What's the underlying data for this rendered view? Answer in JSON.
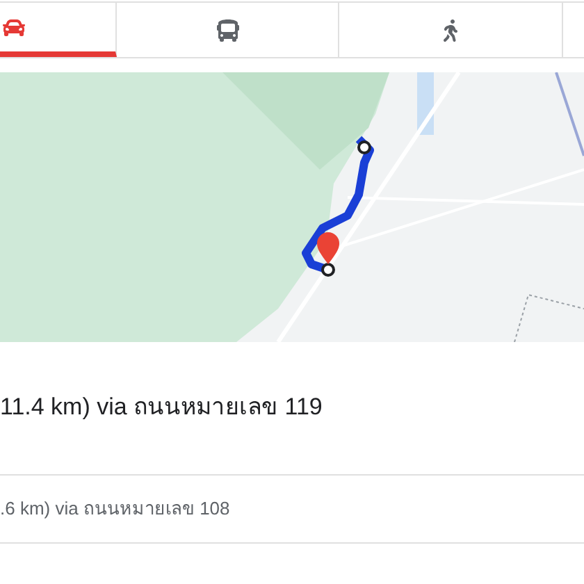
{
  "tabs": [
    {
      "kind": "car",
      "selected": true
    },
    {
      "kind": "transit",
      "selected": false
    },
    {
      "kind": "walk",
      "selected": false
    }
  ],
  "routes": [
    {
      "summary": "11.4 km) via ถนนหมายเลข 119",
      "selected": true
    },
    {
      "summary": ".6 km) via ถนนหมายเลข 108",
      "selected": false
    }
  ]
}
